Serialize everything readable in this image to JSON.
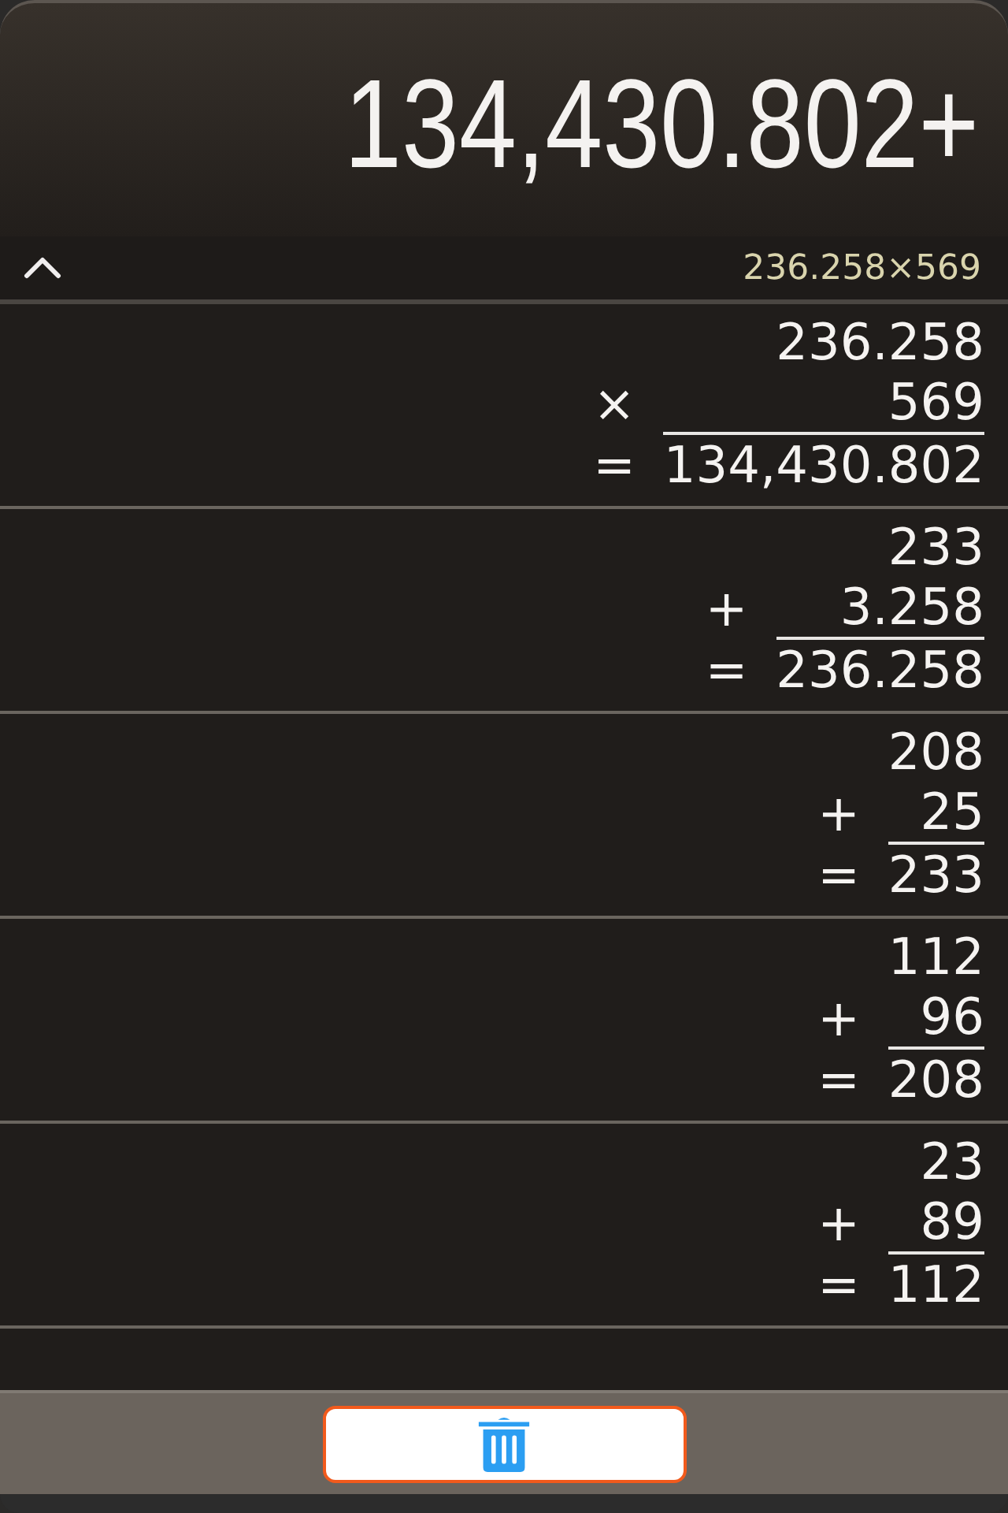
{
  "display": {
    "value": "134,430.802+"
  },
  "history_bar": {
    "expanded": true,
    "expression": "236.258×569"
  },
  "tape": [
    {
      "operand_1": "236.258",
      "operator": "×",
      "operand_2": "569",
      "equals": "=",
      "result": "134,430.802"
    },
    {
      "operand_1": "233",
      "operator": "+",
      "operand_2": "3.258",
      "equals": "=",
      "result": "236.258"
    },
    {
      "operand_1": "208",
      "operator": "+",
      "operand_2": "25",
      "equals": "=",
      "result": "233"
    },
    {
      "operand_1": "112",
      "operator": "+",
      "operand_2": "96",
      "equals": "=",
      "result": "208"
    },
    {
      "operand_1": "23",
      "operator": "+",
      "operand_2": "89",
      "equals": "=",
      "result": "112"
    }
  ],
  "toolbar": {
    "buttons": [
      {
        "kind": "delete"
      }
    ]
  }
}
